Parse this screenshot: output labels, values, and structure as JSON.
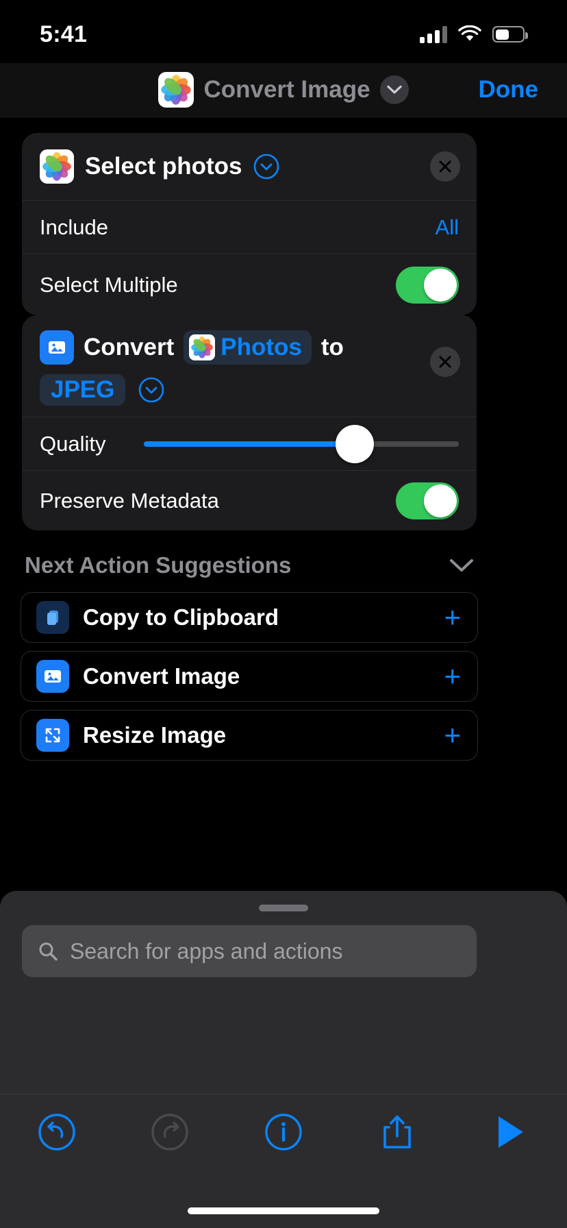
{
  "status_bar": {
    "time": "5:41",
    "cellular_icon": "cellular-bars-icon",
    "wifi_icon": "wifi-icon",
    "battery_icon": "battery-icon"
  },
  "nav_bar": {
    "app_icon": "photos-app-icon",
    "title": "Convert Image",
    "chevron_icon": "chevron-down-icon",
    "done_label": "Done"
  },
  "colors": {
    "accent_blue": "#0a84ff",
    "toggle_green": "#34c759",
    "card_bg": "#1c1c1e",
    "secondary_text": "#8d8d93",
    "screen_bg": "#000000"
  },
  "actions": [
    {
      "icon": "photos-app-icon",
      "title": "Select photos",
      "expand_icon": "chevron-down-circle-icon",
      "remove_icon": "close-icon",
      "rows": [
        {
          "type": "value",
          "label": "Include",
          "value": "All"
        },
        {
          "type": "toggle",
          "label": "Select Multiple",
          "value": "on"
        }
      ]
    },
    {
      "icon": "image-action-icon",
      "title_parts": [
        "Convert",
        "to"
      ],
      "input_token": {
        "icon": "photos-app-icon",
        "label": "Photos"
      },
      "format_token": "JPEG",
      "expand_icon": "chevron-down-circle-icon",
      "remove_icon": "close-icon",
      "rows": [
        {
          "type": "slider",
          "label": "Quality",
          "value": 67
        },
        {
          "type": "toggle",
          "label": "Preserve Metadata",
          "value": "on"
        }
      ]
    }
  ],
  "suggestions": {
    "header": "Next Action Suggestions",
    "collapse_icon": "chevron-down-icon",
    "items": [
      {
        "icon": "clipboard-icon",
        "label": "Copy to Clipboard",
        "add_icon": "plus-icon"
      },
      {
        "icon": "image-action-icon",
        "label": "Convert Image",
        "add_icon": "plus-icon"
      },
      {
        "icon": "resize-icon",
        "label": "Resize Image",
        "add_icon": "plus-icon"
      }
    ]
  },
  "sheet": {
    "grabber": "sheet-grabber",
    "search": {
      "icon": "search-icon",
      "placeholder": "Search for apps and actions",
      "value": ""
    },
    "toolbar": [
      {
        "name": "undo-button",
        "icon": "undo-icon"
      },
      {
        "name": "redo-button",
        "icon": "redo-icon"
      },
      {
        "name": "info-button",
        "icon": "info-icon"
      },
      {
        "name": "share-button",
        "icon": "share-icon"
      },
      {
        "name": "play-button",
        "icon": "play-icon"
      }
    ]
  }
}
